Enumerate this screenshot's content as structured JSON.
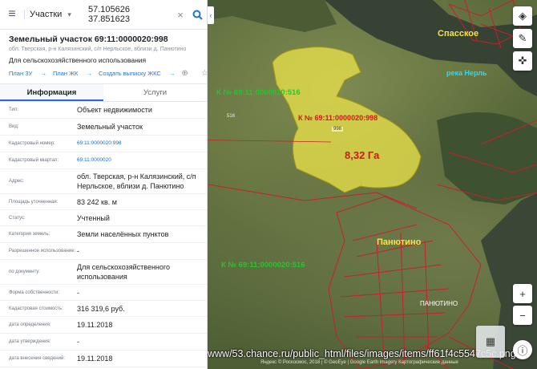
{
  "search": {
    "menu_icon": "hamburger-icon",
    "layer": "Участки",
    "query": "57.105626 37.851623"
  },
  "object": {
    "title": "Земельный участок 69:11:0000020:998",
    "address": "обл. Тверская, р-н Калязинский, с/п Нерльское, вблизи д. Панютино",
    "use": "Для сельскохозяйственного использования",
    "links": [
      "План ЗУ",
      "План ЖК",
      "Создать выписку ЖКС"
    ]
  },
  "tabs": [
    "Информация",
    "Услуги"
  ],
  "info_rows": [
    {
      "key": "Тип:",
      "value": "Объект недвижимости"
    },
    {
      "key": "Вид:",
      "value": "Земельный участок"
    },
    {
      "key": "Кадастровый номер:",
      "value": "69:11:0000020:998"
    },
    {
      "key": "Кадастровый квартал:",
      "value": "69:11:0000020"
    },
    {
      "key": "Адрес:",
      "value": "обл. Тверская, р-н Калязинский, с/п Нерльское, вблизи д. Панютино"
    },
    {
      "key": "Площадь уточненная:",
      "value": "83 242 кв. м"
    },
    {
      "key": "Статус:",
      "value": "Учтенный"
    },
    {
      "key": "Категория земель:",
      "value": "Земли населённых пунктов"
    },
    {
      "key": "Разрешенное использование:",
      "value": "-"
    },
    {
      "key": "по документу:",
      "value": "Для сельскохозяйственного использования"
    },
    {
      "key": "Форма собственности:",
      "value": "-"
    },
    {
      "key": "Кадастровая стоимость:",
      "value": "316 319,6 руб."
    },
    {
      "key": "дата определения:",
      "value": "19.11.2018"
    },
    {
      "key": "дата утверждения:",
      "value": "-"
    },
    {
      "key": "дата внесения сведений:",
      "value": "19.11.2018"
    }
  ],
  "map": {
    "labels": {
      "spasskoe": "Спасское",
      "river": "река Нерль",
      "parcel_516_top": "К № 69:11:0000020:516",
      "parcel_998": "К № 69:11:0000020:998",
      "area": "8,32 Га",
      "panyutino": "Панютино",
      "panyutino_caps": "ПАНЮТИНО",
      "parcel_516_bottom": "К № 69:11:0000020:516",
      "num_998": "998",
      "num_516": "516"
    },
    "url": "www/53.chance.ru/public_html/files/images/items/ff61f4c5547c5c.png",
    "copyright": "Яндекс © Роскосмос, 2018 | © GeoEye | Google Earth Imagery Картографические данные"
  },
  "colors": {
    "parcel_fill": "#e8e04a",
    "boundary": "#c8202a",
    "accent": "#1976d2"
  }
}
